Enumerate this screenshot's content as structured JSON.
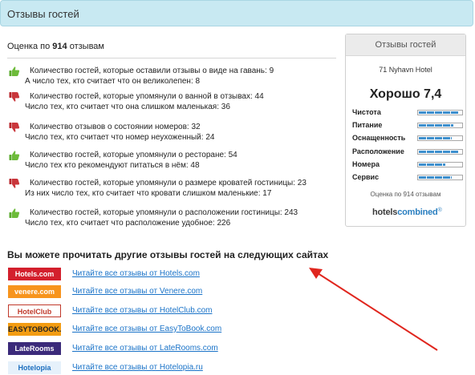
{
  "header": {
    "title": "Отзывы гостей"
  },
  "rating": {
    "prefix": "Оценка по",
    "count": "914",
    "suffix": "отзывам"
  },
  "reviews": [
    {
      "sentiment": "positive",
      "line1": "Количество гостей, которые оставили отзывы о виде на гавань: 9",
      "line2": "А число тех, кто считает что он великолепен: 8"
    },
    {
      "sentiment": "negative",
      "line1": "Количество гостей, которые упомянули о ванной в отзывах: 44",
      "line2": "Число тех, кто считает что она слишком маленькая: 36"
    },
    {
      "sentiment": "negative",
      "line1": "Количество отзывов о состоянии номеров: 32",
      "line2": "Число тех, кто считает что номер неухоженный: 24"
    },
    {
      "sentiment": "positive",
      "line1": "Количество гостей, которые упомянули о ресторане: 54",
      "line2": "Число тех кто рекомендуют питаться в нём: 48"
    },
    {
      "sentiment": "negative",
      "line1": "Количество гостей, которые упомянули о размере кроватей гостиницы: 23",
      "line2": "Из них число тех, кто считает что кровати слишком маленькие: 17"
    },
    {
      "sentiment": "positive",
      "line1": "Количество гостей, которые упомянули о расположении гостиницы: 243",
      "line2": "Число тех, кто считает что расположение удобное: 226"
    }
  ],
  "panel": {
    "title": "Отзывы гостей",
    "hotel": "71 Nyhavn Hotel",
    "score": "Хорошо 7,4",
    "criteria": [
      {
        "label": "Чистота",
        "level": 0.95
      },
      {
        "label": "Питание",
        "level": 0.82
      },
      {
        "label": "Оснащенность",
        "level": 0.78
      },
      {
        "label": "Расположение",
        "level": 0.93
      },
      {
        "label": "Номера",
        "level": 0.62
      },
      {
        "label": "Сервис",
        "level": 0.78
      }
    ],
    "footer": "Оценка по 914 отзывам",
    "logo_part1": "hotels",
    "logo_part2": "combined",
    "logo_mark": "®"
  },
  "other_sites": {
    "title": "Вы можете прочитать другие отзывы гостей на следующих сайтах",
    "sites": [
      {
        "logo": "Hotels.com",
        "logo_bg": "#d3202d",
        "logo_fg": "#ffffff",
        "link": "Читайте все отзывы от Hotels.com"
      },
      {
        "logo": "venere.com",
        "logo_bg": "#f7941d",
        "logo_fg": "#ffffff",
        "link": "Читайте все отзывы от Venere.com"
      },
      {
        "logo": "HotelClub",
        "logo_bg": "#ffffff",
        "logo_fg": "#c0392b",
        "link": "Читайте все отзывы от HotelClub.com"
      },
      {
        "logo": "EASYTOBOOK.COM",
        "logo_bg": "#f39c12",
        "logo_fg": "#222222",
        "link": "Читайте все отзывы от EasyToBook.com"
      },
      {
        "logo": "LateRooms",
        "logo_bg": "#3b2a7a",
        "logo_fg": "#ffffff",
        "link": "Читайте все отзывы от LateRooms.com"
      },
      {
        "logo": "Hotelopia",
        "logo_bg": "#e6f1fb",
        "logo_fg": "#1d6fbf",
        "link": "Читайте все отзывы от Hotelopia.ru"
      }
    ]
  },
  "colors": {
    "header_bg": "#c8e9f2",
    "link": "#1a73c8",
    "thumb_up": "#5bab2e",
    "thumb_down": "#b8272c",
    "arrow": "#e0261e",
    "bar": "#3d8fcd"
  }
}
